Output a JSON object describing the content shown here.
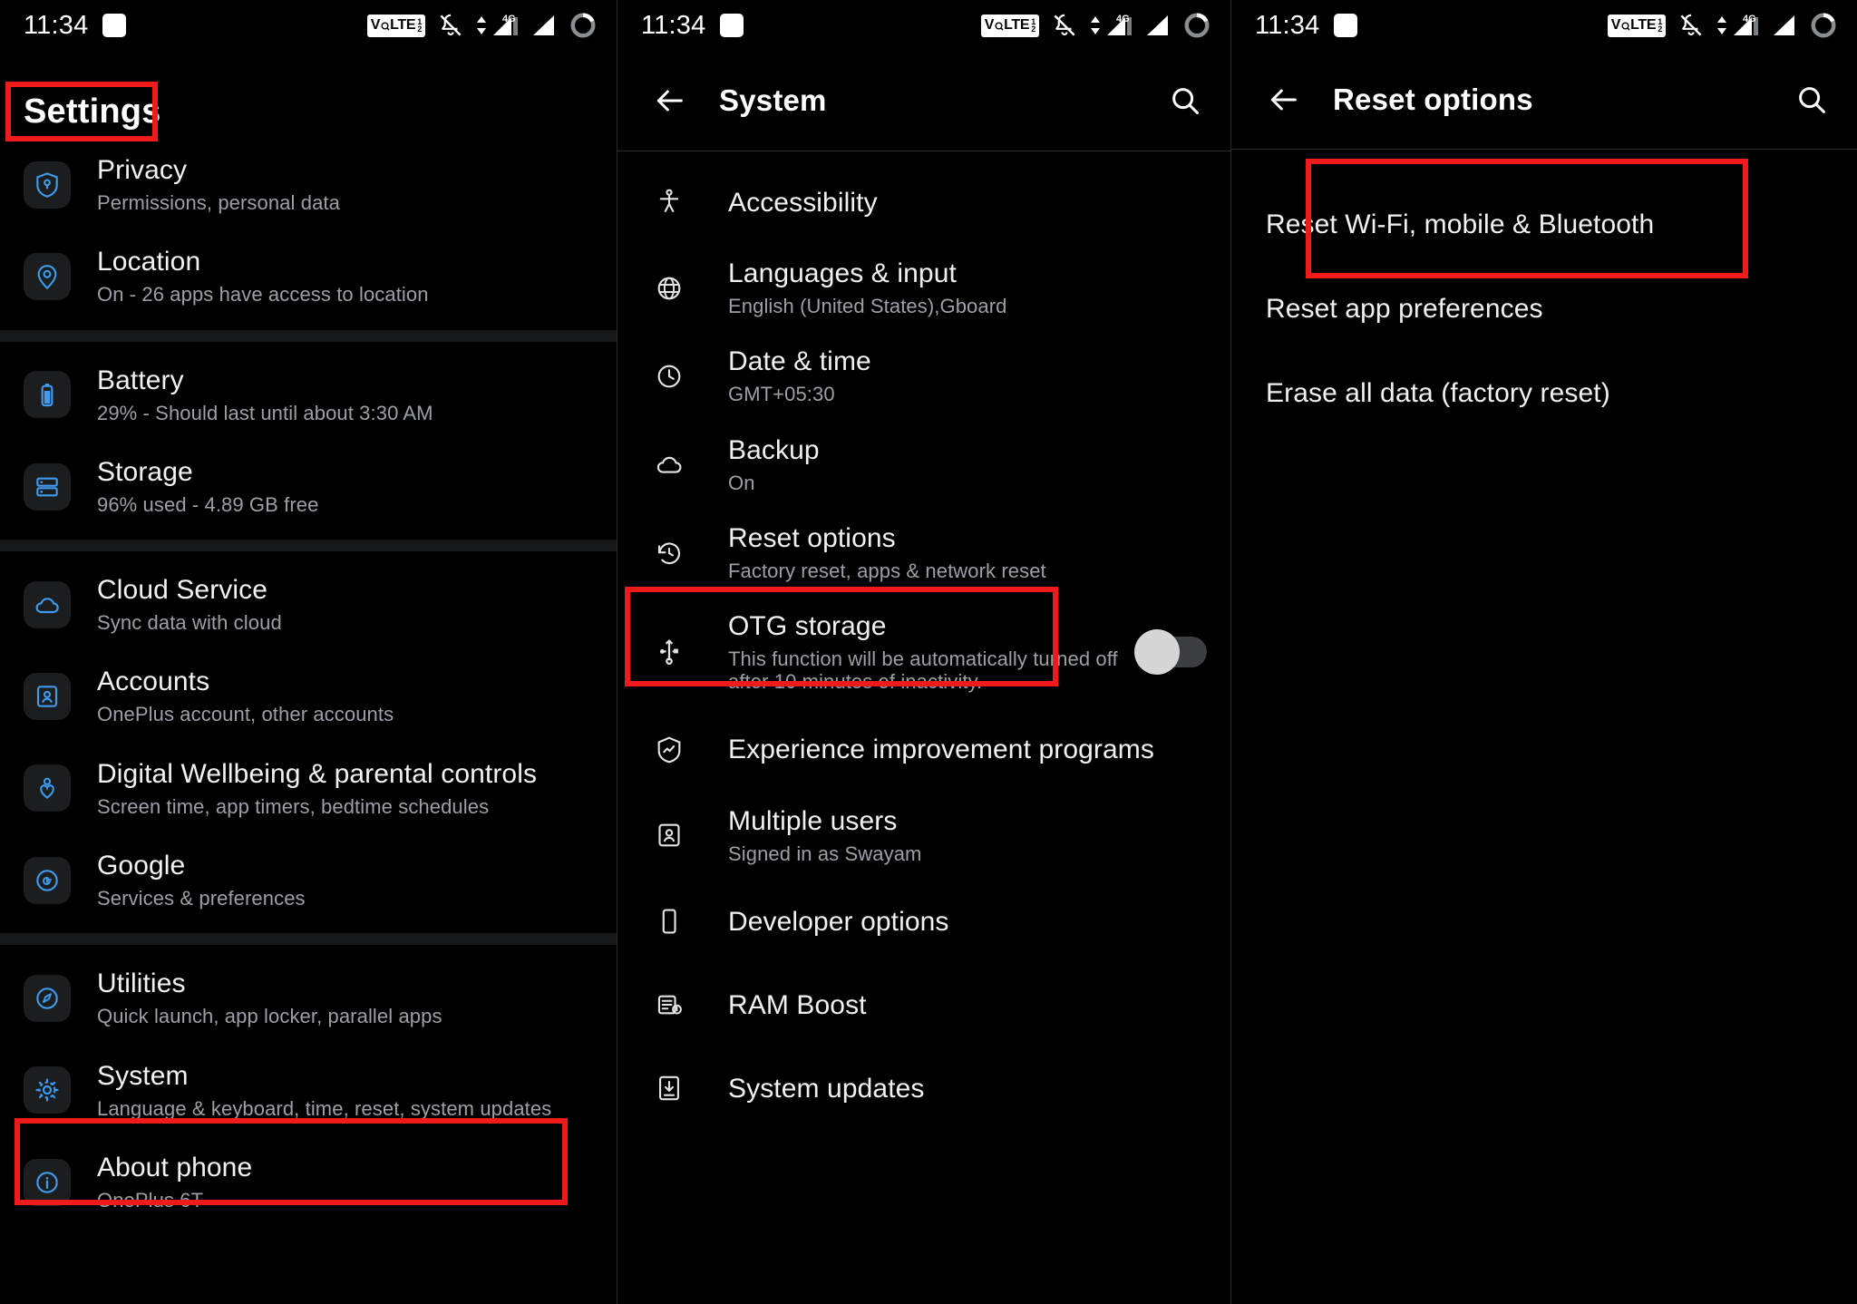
{
  "statusbar": {
    "time": "11:34",
    "icons": [
      "white-square-icon",
      "volte-badge-icon",
      "notifications-muted-icon",
      "mobile-data-4g-icon",
      "signal-bars-icon",
      "battery-circle-icon"
    ],
    "volte_main": "V LTE",
    "volte_v": "V",
    "volte_o": "o",
    "volte_lte": "LTE",
    "volte_sub_top": "1",
    "volte_sub_bottom": "2",
    "network_label": "4G"
  },
  "panel1": {
    "title": "Settings",
    "title_highlighted": true,
    "groups": [
      {
        "items": [
          {
            "icon": "shield-key-icon",
            "title": "Privacy",
            "subtitle": "Permissions, personal data"
          },
          {
            "icon": "location-pin-icon",
            "title": "Location",
            "subtitle": "On - 26 apps have access to location"
          }
        ]
      },
      {
        "items": [
          {
            "icon": "battery-icon",
            "title": "Battery",
            "subtitle": "29% - Should last until about 3:30 AM"
          },
          {
            "icon": "storage-icon",
            "title": "Storage",
            "subtitle": "96% used - 4.89 GB free"
          }
        ]
      },
      {
        "items": [
          {
            "icon": "cloud-icon",
            "title": "Cloud Service",
            "subtitle": "Sync data with cloud"
          },
          {
            "icon": "account-card-icon",
            "title": "Accounts",
            "subtitle": "OnePlus account, other accounts"
          },
          {
            "icon": "wellbeing-heart-icon",
            "title": "Digital Wellbeing & parental controls",
            "subtitle": "Screen time, app timers, bedtime schedules"
          },
          {
            "icon": "google-g-icon",
            "title": "Google",
            "subtitle": "Services & preferences"
          }
        ]
      },
      {
        "items": [
          {
            "icon": "utilities-icon",
            "title": "Utilities",
            "subtitle": "Quick launch, app locker, parallel apps"
          },
          {
            "icon": "gear-icon",
            "title": "System",
            "subtitle": "Language & keyboard, time, reset, system updates",
            "highlighted": true
          },
          {
            "icon": "info-icon",
            "title": "About phone",
            "subtitle": "OnePlus 6T"
          }
        ]
      }
    ]
  },
  "panel2": {
    "appbar": {
      "back": "back-arrow-icon",
      "title": "System",
      "search": "search-icon"
    },
    "items": [
      {
        "icon": "accessibility-icon",
        "title": "Accessibility",
        "subtitle": ""
      },
      {
        "icon": "globe-icon",
        "title": "Languages & input",
        "subtitle": "English (United States),Gboard"
      },
      {
        "icon": "clock-icon",
        "title": "Date & time",
        "subtitle": "GMT+05:30"
      },
      {
        "icon": "cloud-icon",
        "title": "Backup",
        "subtitle": "On"
      },
      {
        "icon": "history-reset-icon",
        "title": "Reset options",
        "subtitle": "Factory reset, apps & network reset",
        "highlighted": true
      },
      {
        "icon": "usb-otg-icon",
        "title": "OTG storage",
        "subtitle": "This function will be automatically turned off after 10 minutes of inactivity.",
        "toggle": "off"
      },
      {
        "icon": "experience-chart-icon",
        "title": "Experience improvement programs",
        "subtitle": ""
      },
      {
        "icon": "multiple-users-icon",
        "title": "Multiple users",
        "subtitle": "Signed in as  Swayam"
      },
      {
        "icon": "developer-phone-icon",
        "title": "Developer options",
        "subtitle": ""
      },
      {
        "icon": "ram-boost-icon",
        "title": "RAM Boost",
        "subtitle": ""
      },
      {
        "icon": "system-updates-icon",
        "title": "System updates",
        "subtitle": ""
      }
    ]
  },
  "panel3": {
    "appbar": {
      "back": "back-arrow-icon",
      "title": "Reset options",
      "search": "search-icon"
    },
    "items": [
      {
        "title": "Reset Wi-Fi, mobile & Bluetooth",
        "highlighted": true
      },
      {
        "title": "Reset app preferences"
      },
      {
        "title": "Erase all data (factory reset)"
      }
    ]
  },
  "colors": {
    "highlight": "#f11a1a",
    "accent_blue": "#3d9bf0",
    "bg": "#000000",
    "tile": "#1b1d1f"
  }
}
